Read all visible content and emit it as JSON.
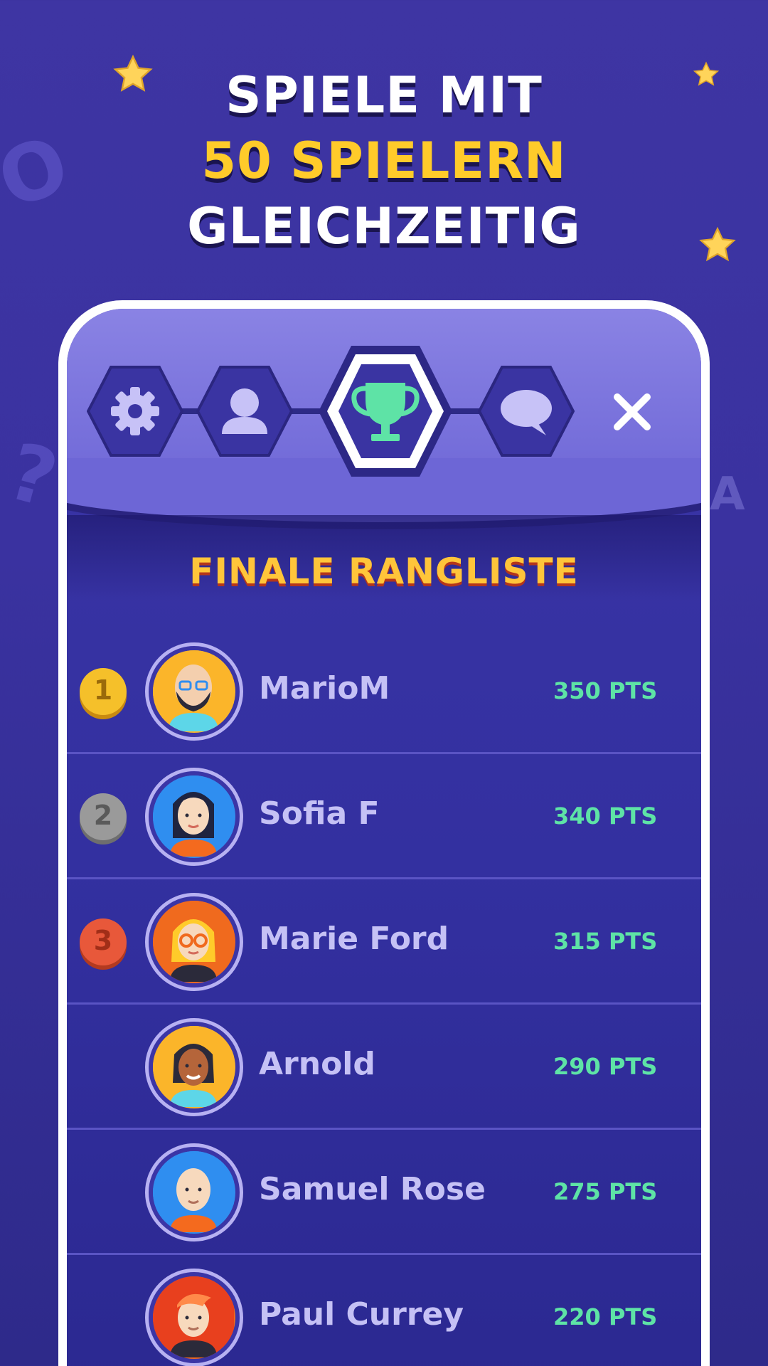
{
  "headline": {
    "line1": "SPIELE MIT",
    "line2": "50 SPIELERN",
    "line3": "GLEICHZEITIG"
  },
  "background_letters": [
    "O",
    "?",
    "A"
  ],
  "nav": {
    "items": [
      {
        "name": "settings",
        "icon": "gear-icon"
      },
      {
        "name": "profile",
        "icon": "user-icon"
      },
      {
        "name": "leaderboard",
        "icon": "trophy-icon",
        "active": true
      },
      {
        "name": "chat",
        "icon": "chat-icon"
      }
    ],
    "close_icon": "close-icon"
  },
  "leaderboard": {
    "title": "FINALE RANGLISTE",
    "players": [
      {
        "rank": "1",
        "name": "MarioM",
        "points": "350 PTS",
        "avatar_bg": "#fbb52a"
      },
      {
        "rank": "2",
        "name": "Sofia F",
        "points": "340 PTS",
        "avatar_bg": "#2f8ef0"
      },
      {
        "rank": "3",
        "name": "Marie Ford",
        "points": "315 PTS",
        "avatar_bg": "#f06a1e"
      },
      {
        "rank": "",
        "name": "Arnold",
        "points": "290 PTS",
        "avatar_bg": "#fbb52a"
      },
      {
        "rank": "",
        "name": "Samuel Rose",
        "points": "275 PTS",
        "avatar_bg": "#2f8ef0"
      },
      {
        "rank": "",
        "name": "Paul Currey",
        "points": "220 PTS",
        "avatar_bg": "#f06a1e"
      }
    ]
  },
  "colors": {
    "background": "#3e35a3",
    "accent_yellow": "#ffcb2a",
    "points_green": "#5ee3a6",
    "gold": "#f5c02a",
    "silver": "#9a9a9a",
    "bronze": "#e8583a"
  }
}
